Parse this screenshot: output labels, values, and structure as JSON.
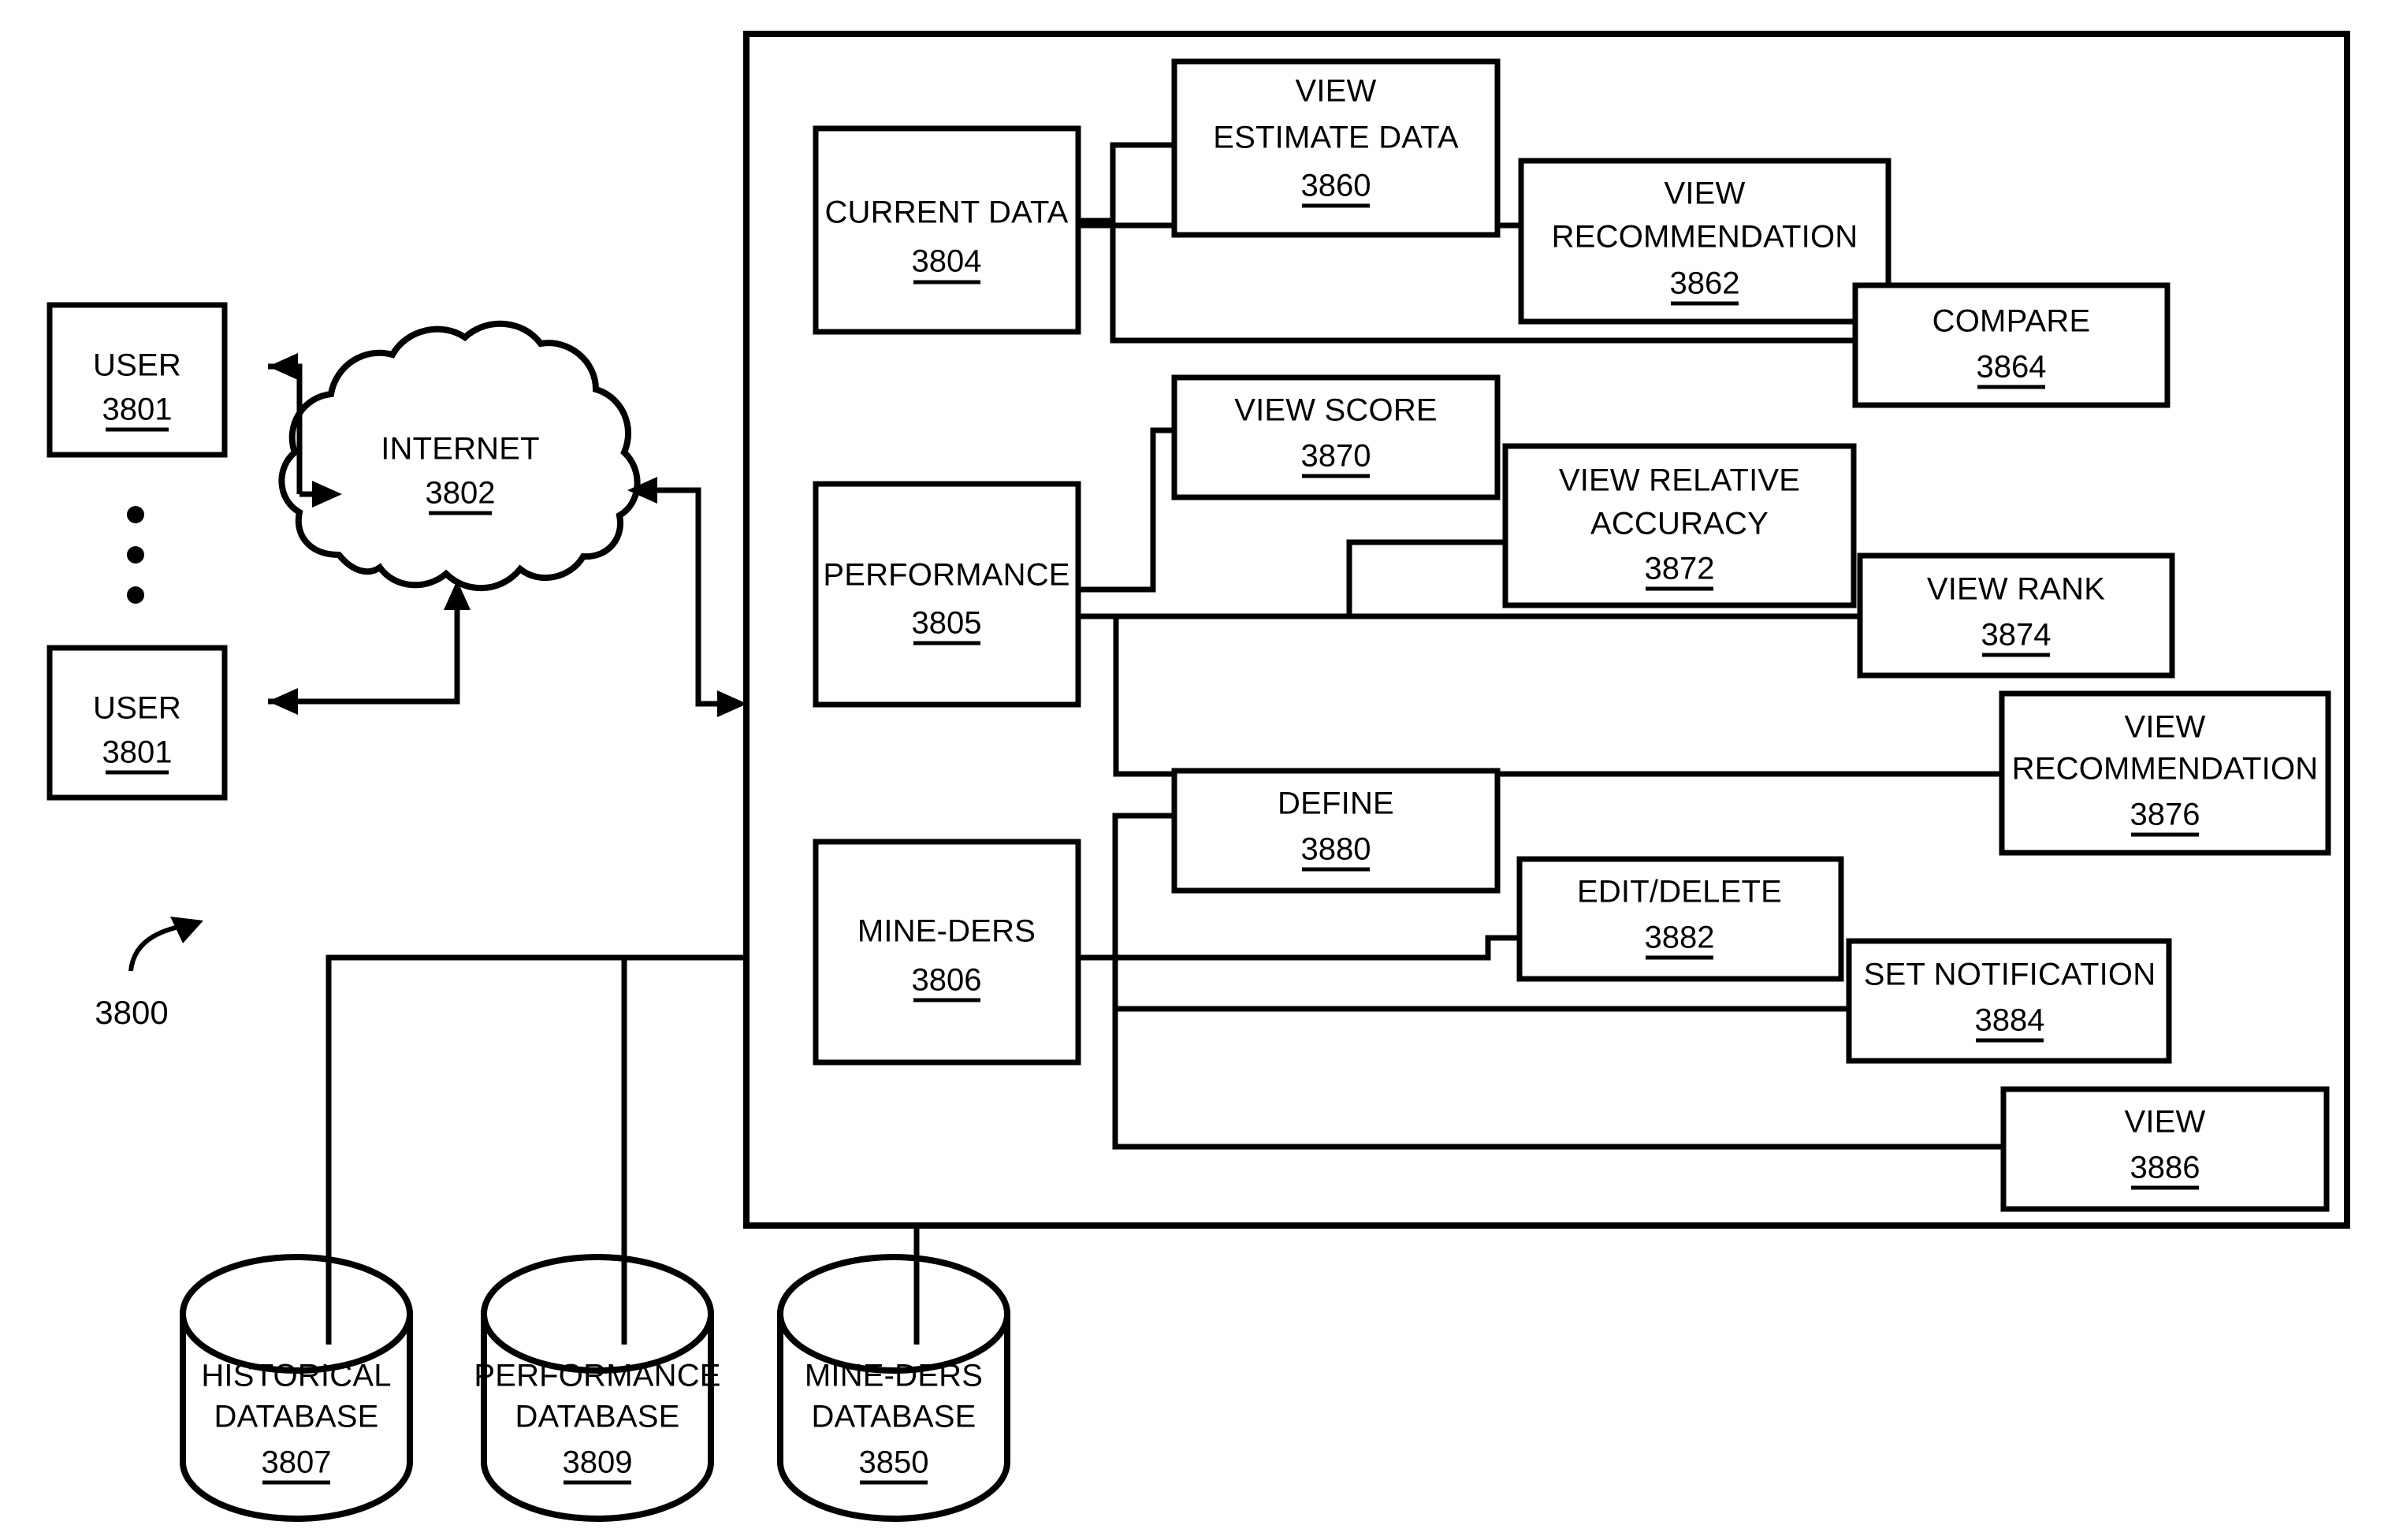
{
  "figure": {
    "reference_label": "3800",
    "line_color": "#000000",
    "background_color": "#ffffff"
  },
  "left_side": {
    "user_top": {
      "label": "USER",
      "ref": "3801"
    },
    "user_bottom": {
      "label": "USER",
      "ref": "3801"
    },
    "ellipsis_dots": 3,
    "cloud": {
      "label": "INTERNET",
      "ref": "3802"
    }
  },
  "system": {
    "rows": [
      {
        "source": {
          "label": "CURRENT DATA",
          "ref": "3804"
        },
        "targets": [
          {
            "label_line1": "VIEW",
            "label_line2": "ESTIMATE DATA",
            "label": "VIEW ESTIMATE DATA",
            "ref": "3860"
          },
          {
            "label_line1": "VIEW",
            "label_line2": "RECOMMENDATION",
            "label": "VIEW RECOMMENDATION",
            "ref": "3862"
          },
          {
            "label_line1": "COMPARE",
            "label_line2": "",
            "label": "COMPARE",
            "ref": "3864"
          }
        ]
      },
      {
        "source": {
          "label": "PERFORMANCE",
          "ref": "3805"
        },
        "targets": [
          {
            "label_line1": "VIEW SCORE",
            "label_line2": "",
            "label": "VIEW SCORE",
            "ref": "3870"
          },
          {
            "label_line1": "VIEW RELATIVE",
            "label_line2": "ACCURACY",
            "label": "VIEW RELATIVE ACCURACY",
            "ref": "3872"
          },
          {
            "label_line1": "VIEW RANK",
            "label_line2": "",
            "label": "VIEW RANK",
            "ref": "3874"
          },
          {
            "label_line1": "VIEW",
            "label_line2": "RECOMMENDATION",
            "label": "VIEW RECOMMENDATION",
            "ref": "3876"
          }
        ]
      },
      {
        "source": {
          "label": "MINE-DERS",
          "ref": "3806"
        },
        "targets": [
          {
            "label_line1": "DEFINE",
            "label_line2": "",
            "label": "DEFINE",
            "ref": "3880"
          },
          {
            "label_line1": "EDIT/DELETE",
            "label_line2": "",
            "label": "EDIT/DELETE",
            "ref": "3882"
          },
          {
            "label_line1": "SET NOTIFICATION",
            "label_line2": "",
            "label": "SET NOTIFICATION",
            "ref": "3884"
          },
          {
            "label_line1": "VIEW",
            "label_line2": "",
            "label": "VIEW",
            "ref": "3886"
          }
        ]
      }
    ]
  },
  "databases": [
    {
      "label_line1": "HISTORICAL",
      "label_line2": "DATABASE",
      "label": "HISTORICAL DATABASE",
      "ref": "3807"
    },
    {
      "label_line1": "PERFORMANCE",
      "label_line2": "DATABASE",
      "label": "PERFORMANCE DATABASE",
      "ref": "3809"
    },
    {
      "label_line1": "MINE-DERS",
      "label_line2": "DATABASE",
      "label": "MINE-DERS DATABASE",
      "ref": "3850"
    }
  ]
}
